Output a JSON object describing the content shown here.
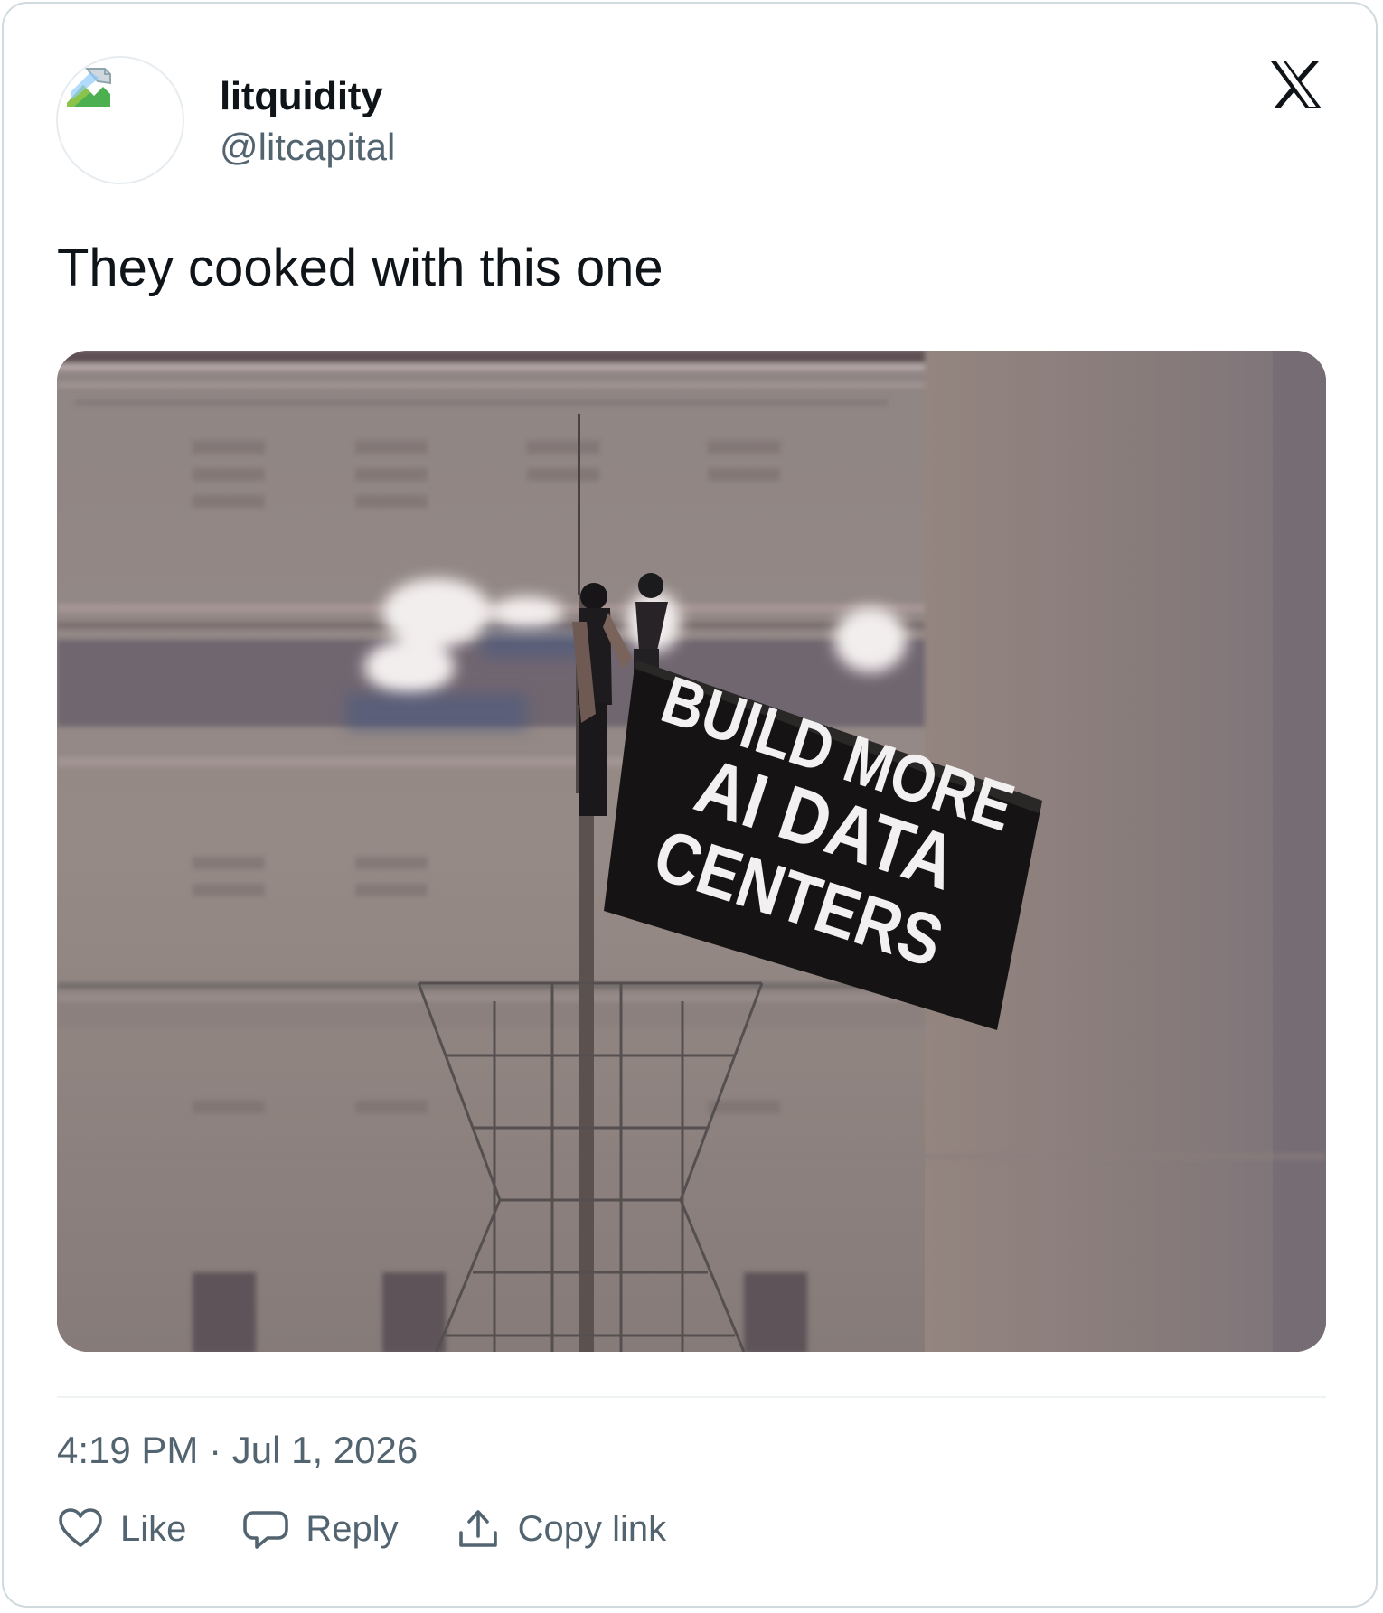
{
  "author": {
    "name": "litquidity",
    "handle": "@litcapital",
    "avatar": "broken-image-icon"
  },
  "platform_icon": "x-logo-icon",
  "tweet": {
    "text": "They cooked with this one",
    "media": {
      "flag_lines": [
        "BUILD MORE",
        "AI DATA",
        "CENTERS"
      ]
    },
    "timestamp": "4:19 PM · Jul 1, 2026"
  },
  "actions": [
    {
      "label": "Like",
      "icon": "heart-icon"
    },
    {
      "label": "Reply",
      "icon": "speech-bubble-icon"
    },
    {
      "label": "Copy link",
      "icon": "upload-icon"
    }
  ],
  "colors": {
    "text_primary": "#0f1419",
    "text_secondary": "#536471",
    "border": "#cfd9de"
  }
}
